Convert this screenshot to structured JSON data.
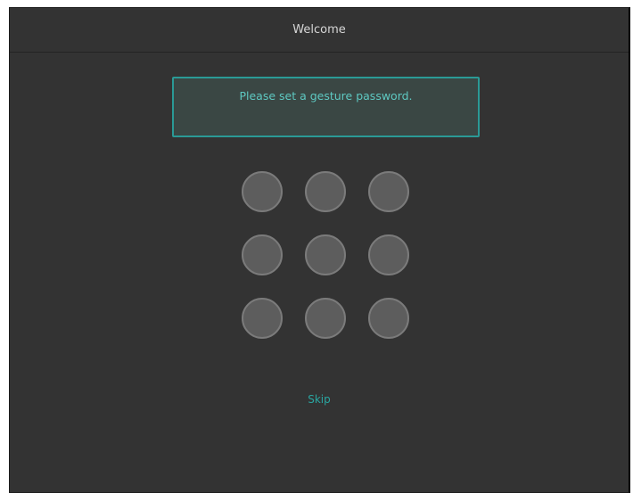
{
  "window": {
    "title": "Welcome"
  },
  "prompt": {
    "text": "Please set a gesture password."
  },
  "gesture_grid": {
    "rows": 3,
    "cols": 3,
    "selected": []
  },
  "actions": {
    "skip_label": "Skip"
  },
  "colors": {
    "background": "#333333",
    "accent": "#2a9a96",
    "dot_fill": "#5d5d5d",
    "dot_border": "#7b7b7b"
  }
}
